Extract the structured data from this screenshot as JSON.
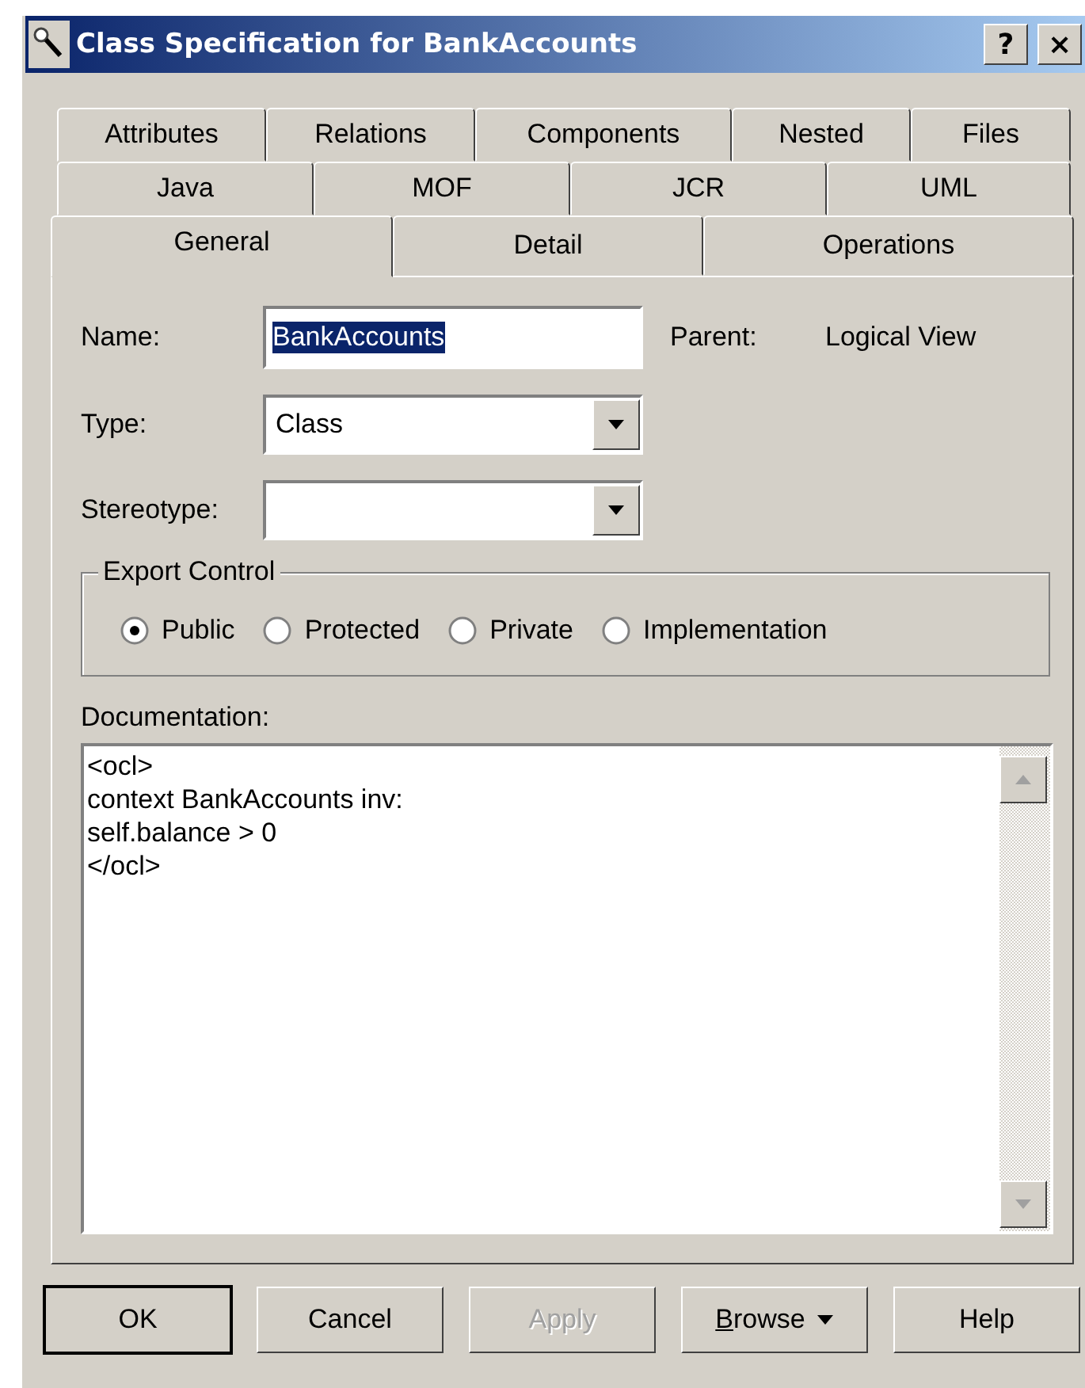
{
  "window": {
    "title": "Class Specification for BankAccounts",
    "title_buttons": [
      "?",
      "×"
    ]
  },
  "tab_rows": [
    [
      {
        "label": "Attributes",
        "selected": false
      },
      {
        "label": "Relations",
        "selected": false
      },
      {
        "label": "Components",
        "selected": false
      },
      {
        "label": "Nested",
        "selected": false
      },
      {
        "label": "Files",
        "selected": false
      }
    ],
    [
      {
        "label": "Java",
        "selected": false
      },
      {
        "label": "MOF",
        "selected": false
      },
      {
        "label": "JCR",
        "selected": false
      },
      {
        "label": "UML",
        "selected": false
      }
    ],
    [
      {
        "label": "General",
        "selected": true
      },
      {
        "label": "Detail",
        "selected": false
      },
      {
        "label": "Operations",
        "selected": false
      }
    ]
  ],
  "name": {
    "label": "Name:",
    "value": "BankAccounts",
    "text_selected": true
  },
  "parent": {
    "label": "Parent:",
    "value": "Logical View"
  },
  "type": {
    "label": "Type:",
    "value": "Class"
  },
  "stereotype": {
    "label": "Stereotype:"
  },
  "export_control": {
    "title": "Export Control",
    "options": [
      {
        "label": "Public",
        "selected": true
      },
      {
        "label": "Protected",
        "selected": false
      },
      {
        "label": "Private",
        "selected": false
      },
      {
        "label": "Implementation",
        "selected": false
      }
    ]
  },
  "documentation": {
    "label": "Documentation:",
    "text": "<ocl>\ncontext BankAccounts inv:\nself.balance > 0\n</ocl>"
  },
  "buttons": [
    {
      "label": "OK",
      "disabled": false,
      "default": true,
      "mnemonic": false,
      "menu": false
    },
    {
      "label": "Cancel",
      "disabled": false,
      "default": false,
      "mnemonic": false,
      "menu": false
    },
    {
      "label": "Apply",
      "disabled": true,
      "default": false,
      "mnemonic": false,
      "menu": false
    },
    {
      "label": "Browse",
      "disabled": false,
      "default": false,
      "mnemonic": true,
      "menu": true
    },
    {
      "label": "Help",
      "disabled": false,
      "default": false,
      "mnemonic": false,
      "menu": false
    }
  ]
}
